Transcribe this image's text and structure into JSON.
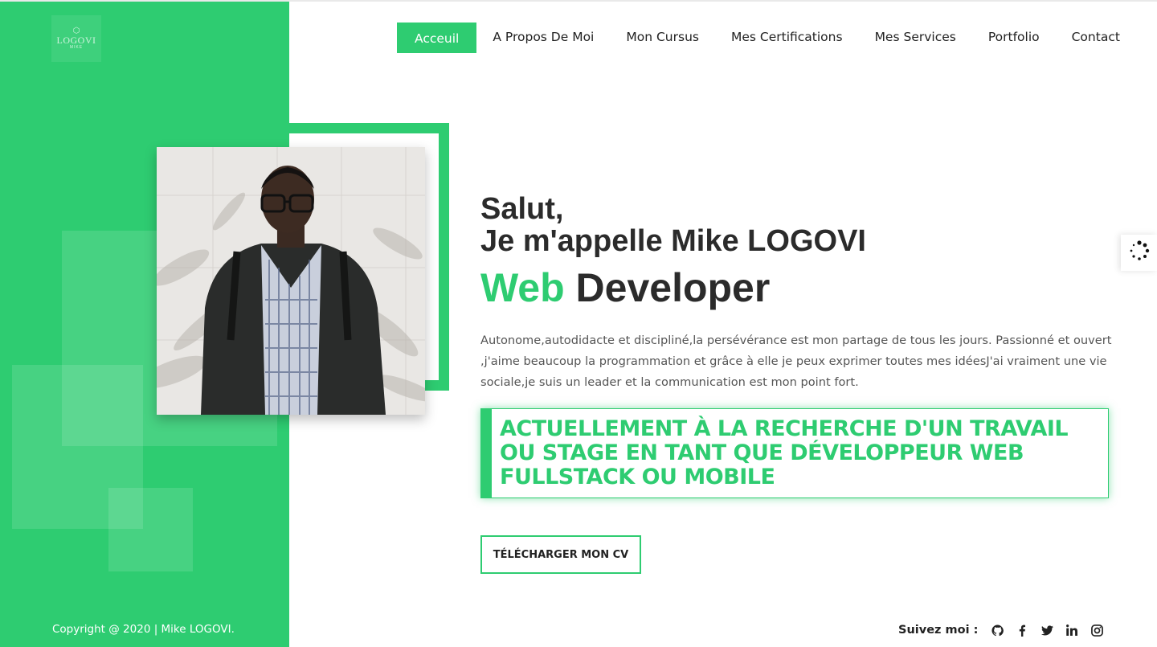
{
  "logo": {
    "name": "LOGOVI",
    "sub": "MIKE",
    "icon": "cube-icon"
  },
  "nav": {
    "items": [
      {
        "label": "Acceuil",
        "active": true
      },
      {
        "label": "A Propos De Moi",
        "active": false
      },
      {
        "label": "Mon Cursus",
        "active": false
      },
      {
        "label": "Mes Certifications",
        "active": false
      },
      {
        "label": "Mes Services",
        "active": false
      },
      {
        "label": "Portfolio",
        "active": false
      },
      {
        "label": "Contact",
        "active": false
      }
    ]
  },
  "hero": {
    "greeting_line1": "Salut,",
    "greeting_line2": "Je m'appelle Mike LOGOVI",
    "title_accent": "Web",
    "title_rest": "Developer",
    "bio": "Autonome,autodidacte et discipliné,la persévérance est mon partage de tous les jours. Passionné et ouvert ,j'aime beaucoup la programmation et grâce à elle je peux exprimer toutes mes idéesJ'ai vraiment une vie sociale,je suis un leader et la communication est mon point fort.",
    "banner": "ACTUELLEMENT À LA RECHERCHE D'UN TRAVAIL OU STAGE EN TANT QUE DÉVELOPPEUR WEB FULLSTACK OU MOBILE",
    "cv_button": "TÉLÉCHARGER MON CV"
  },
  "footer": {
    "copyright": "Copyright @ 2020 | Mike LOGOVI.",
    "social_label": "Suivez moi :",
    "social_icons": [
      "github-icon",
      "facebook-icon",
      "twitter-icon",
      "linkedin-icon",
      "instagram-icon"
    ]
  },
  "side_widget": {
    "icon": "loading-spinner-icon"
  },
  "colors": {
    "accent": "#2ecc71",
    "text_dark": "#2b2b2b",
    "text_body": "#555555"
  }
}
